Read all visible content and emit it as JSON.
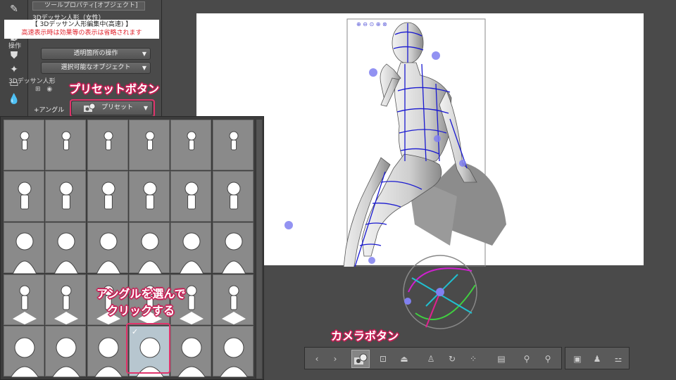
{
  "tool_property": {
    "title": "ツールプロパティ[オブジェクト]",
    "subtool": "3Dデッサン人形（女性）",
    "notice_line1": "【 3Dデッサン人形編集中(高速) 】",
    "notice_line2": "高速表示時は効果等の表示は省略されます",
    "operation_label": "操作",
    "transparent_op": "透明箇所の操作",
    "selectable_obj": "選択可能なオブジェクト",
    "doll_section": "3Dデッサン人形",
    "angle_label": "アングル",
    "preset_label": "プリセット"
  },
  "callouts": {
    "preset_button": "プリセットボタン",
    "choose_angle_1": "アングルを選んで",
    "choose_angle_2": "クリックする",
    "camera_button": "カメラボタン"
  },
  "preset_grid": {
    "rows": 5,
    "cols": 6,
    "selected_row": 4,
    "selected_col": 3,
    "selected_mark": "✓"
  },
  "colors": {
    "highlight": "#e0336b",
    "notice_red": "#e0202a",
    "canvas": "#ffffff",
    "handle": "#8080f0"
  },
  "icons": {
    "tool_strip": [
      "pen-icon",
      "brush-icon",
      "paint-icon",
      "sparkle-icon",
      "eraser-icon",
      "drops-icon"
    ],
    "toolbar": [
      "prev-icon",
      "next-icon",
      "camera-icon",
      "move-icon",
      "floor-icon",
      "pose-icon",
      "rotate-icon",
      "dots-icon",
      "fit-icon",
      "skeleton-icon",
      "skeleton-icon",
      "presets-icon",
      "person-icon",
      "bone-icon"
    ]
  }
}
